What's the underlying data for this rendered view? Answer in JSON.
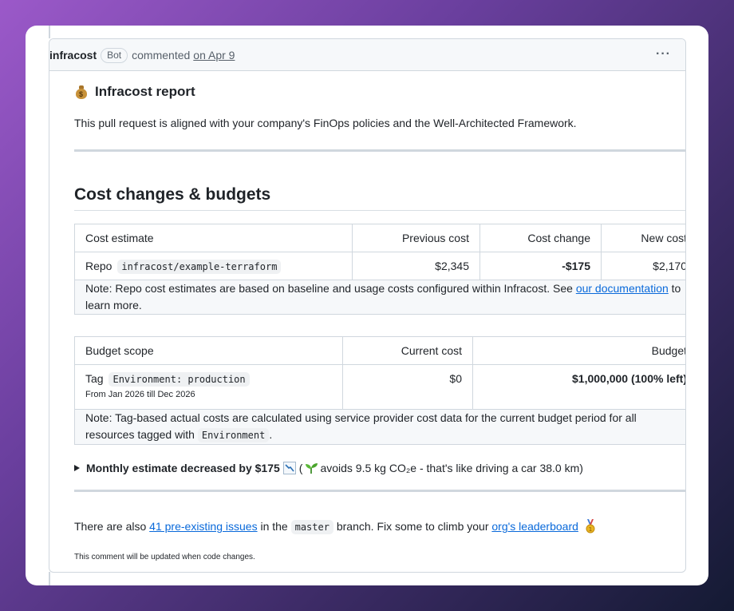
{
  "header": {
    "author": "infracost",
    "badge": "Bot",
    "action": "commented",
    "date": "on Apr 9",
    "more_icon": "kebab-horizontal-icon"
  },
  "report": {
    "icon": "money-bag-icon",
    "title": "Infracost report",
    "intro": "This pull request is aligned with your company's FinOps policies and the Well-Architected Framework."
  },
  "costs": {
    "heading": "Cost changes & budgets",
    "columns": [
      "Cost estimate",
      "Previous cost",
      "Cost change",
      "New cost"
    ],
    "row": {
      "label": "Repo",
      "repo": "infracost/example-terraform",
      "previous": "$2,345",
      "change": "-$175",
      "new": "$2,170"
    },
    "note_prefix": "Note: Repo cost estimates are based on baseline and usage costs configured within Infracost. See ",
    "note_link": "our documentation",
    "note_suffix": " to learn more."
  },
  "budgets": {
    "columns": [
      "Budget scope",
      "Current cost",
      "Budget"
    ],
    "row": {
      "label": "Tag",
      "tag": "Environment: production",
      "period": "From Jan 2026 till Dec 2026",
      "current": "$0",
      "budget": "$1,000,000 (100% left)"
    },
    "note_prefix": "Note: Tag-based actual costs are calculated using service provider cost data for the current budget period for all resources tagged with ",
    "note_code": "Environment",
    "note_suffix": "."
  },
  "summary": {
    "bold": "Monthly estimate decreased by $175",
    "chart_icon": "chart-decreasing-icon",
    "open_paren": "(",
    "sprout_icon": "seedling-icon",
    "text": " avoids 9.5 kg CO₂e - that's like driving a car 38.0 km)"
  },
  "footer": {
    "prefix": "There are also ",
    "issues_link": "41 pre-existing issues",
    "middle": " in the ",
    "branch": "master",
    "suffix": " branch. Fix some to climb your ",
    "leaderboard_link": "org's leaderboard",
    "medal_icon": "medal-icon",
    "updated_note": "This comment will be updated when code changes."
  },
  "colors": {
    "link": "#0969da",
    "border": "#d0d7de",
    "header_bg": "#f6f8fa"
  }
}
